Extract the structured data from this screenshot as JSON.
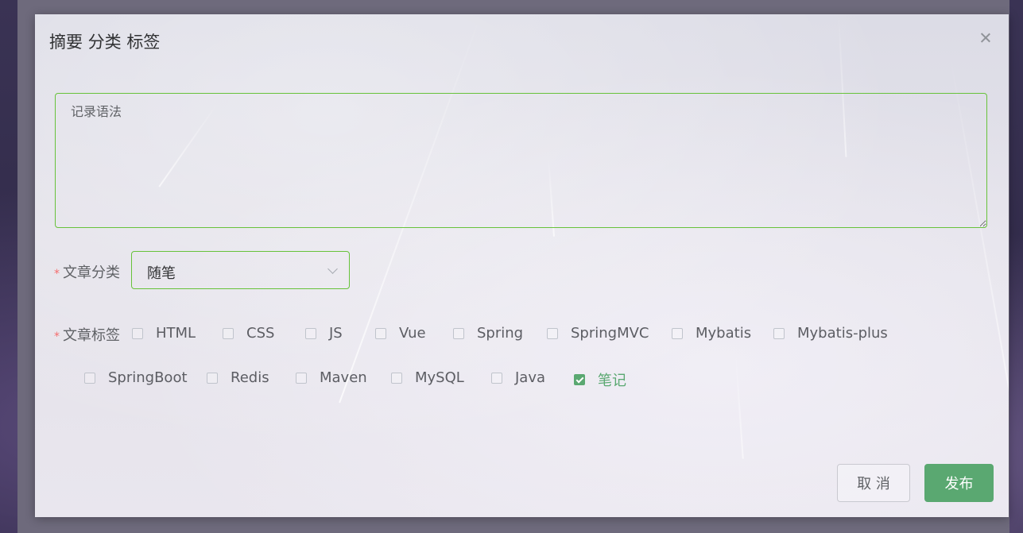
{
  "dialog": {
    "title": "摘要 分类 标签",
    "close_icon": "close-icon"
  },
  "summary": {
    "placeholder": "记录语法",
    "value": ""
  },
  "category": {
    "label": "文章分类",
    "required_mark": "*",
    "selected": "随笔",
    "icon": "chevron-down-icon"
  },
  "tags": {
    "label": "文章标签",
    "required_mark": "*",
    "items": [
      {
        "label": "HTML",
        "checked": false
      },
      {
        "label": "CSS",
        "checked": false
      },
      {
        "label": "JS",
        "checked": false
      },
      {
        "label": "Vue",
        "checked": false
      },
      {
        "label": "Spring",
        "checked": false
      },
      {
        "label": "SpringMVC",
        "checked": false
      },
      {
        "label": "Mybatis",
        "checked": false
      },
      {
        "label": "Mybatis-plus",
        "checked": false
      },
      {
        "label": "SpringBoot",
        "checked": false
      },
      {
        "label": "Redis",
        "checked": false
      },
      {
        "label": "Maven",
        "checked": false
      },
      {
        "label": "MySQL",
        "checked": false
      },
      {
        "label": "Java",
        "checked": false
      },
      {
        "label": "笔记",
        "checked": true
      }
    ]
  },
  "footer": {
    "cancel_label": "取 消",
    "publish_label": "发布"
  },
  "colors": {
    "accent": "#5aa871",
    "focus_border": "#67c23a",
    "required": "#f56c6c"
  }
}
